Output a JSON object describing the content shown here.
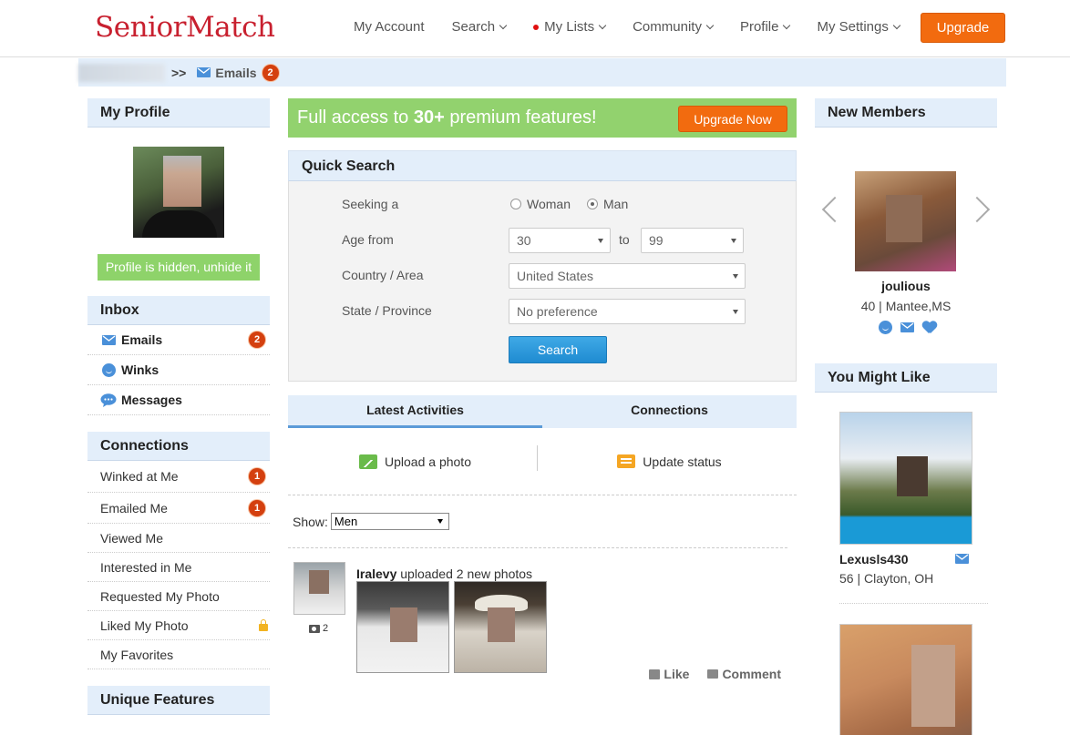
{
  "brand": {
    "logo": "SeniorMatch",
    "accent": "#f26b0f",
    "logo_color": "#c8202f",
    "light_blue": "#e3eefa",
    "green": "#92d26e"
  },
  "nav": {
    "items": [
      {
        "label": "My Account",
        "has_chevron": false,
        "dot": false
      },
      {
        "label": "Search",
        "has_chevron": true,
        "dot": false
      },
      {
        "label": "My Lists",
        "has_chevron": true,
        "dot": true
      },
      {
        "label": "Community",
        "has_chevron": true,
        "dot": false
      },
      {
        "label": "Profile",
        "has_chevron": true,
        "dot": false
      },
      {
        "label": "My Settings",
        "has_chevron": true,
        "dot": false
      }
    ],
    "upgrade": "Upgrade"
  },
  "breadcrumb": {
    "separator": ">>",
    "label": "Emails",
    "count": "2"
  },
  "left": {
    "my_profile": {
      "title": "My Profile",
      "hidden_btn": "Profile is hidden, unhide it"
    },
    "inbox": {
      "title": "Inbox",
      "items": [
        {
          "label": "Emails",
          "icon": "envelope-icon",
          "badge": "2"
        },
        {
          "label": "Winks",
          "icon": "smile-icon",
          "badge": ""
        },
        {
          "label": "Messages",
          "icon": "chat-bubble-icon",
          "badge": ""
        }
      ]
    },
    "connections": {
      "title": "Connections",
      "items": [
        {
          "label": "Winked at Me",
          "badge": "1"
        },
        {
          "label": "Emailed Me",
          "badge": "1"
        },
        {
          "label": "Viewed Me",
          "badge": ""
        },
        {
          "label": "Interested in Me",
          "badge": ""
        },
        {
          "label": "Requested My Photo",
          "badge": ""
        },
        {
          "label": "Liked My Photo",
          "badge": "",
          "locked": true
        },
        {
          "label": "My Favorites",
          "badge": ""
        }
      ]
    },
    "unique": {
      "title": "Unique Features"
    }
  },
  "promo": {
    "prefix": "Full access to ",
    "bold": "30+",
    "suffix": " premium features!",
    "button": "Upgrade Now"
  },
  "quick_search": {
    "title": "Quick Search",
    "seeking_label": "Seeking a",
    "options": [
      "Woman",
      "Man"
    ],
    "selected": "Man",
    "age_label": "Age from",
    "age_from": "30",
    "age_to_label": "to",
    "age_to": "99",
    "country_label": "Country / Area",
    "country": "United States",
    "state_label": "State / Province",
    "state": "No preference",
    "search_button": "Search"
  },
  "activity": {
    "tabs": [
      "Latest Activities",
      "Connections"
    ],
    "active_tab": "Latest Activities",
    "upload": "Upload a photo",
    "status": "Update status",
    "show_label": "Show:",
    "show_value": "Men",
    "post": {
      "user": "Iralevy",
      "text": " uploaded 2 new photos",
      "photo_count": "2",
      "like": "Like",
      "comment": "Comment"
    }
  },
  "right": {
    "new_members": {
      "title": "New Members",
      "name": "joulious",
      "meta": "40 | Mantee,MS"
    },
    "you_might_like": {
      "title": "You Might Like",
      "cards": [
        {
          "name": "Lexusls430",
          "meta": "56 | Clayton, OH"
        }
      ]
    }
  }
}
